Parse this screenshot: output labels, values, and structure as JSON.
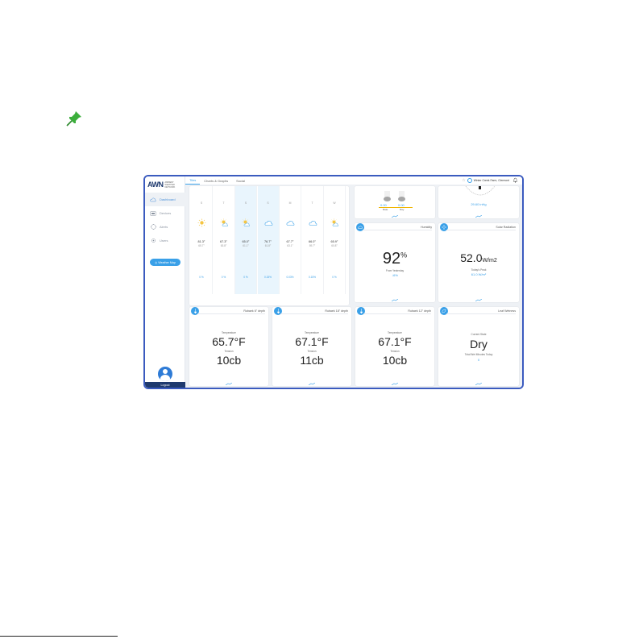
{
  "app": {
    "logo_mark": "AWN",
    "logo_text": "AMBIENT WEATHER NETWORK",
    "station_name": "Winter Creek Farm, Clermont"
  },
  "nav": {
    "items": [
      {
        "label": "Dashboard",
        "active": true,
        "icon": "cloud-icon"
      },
      {
        "label": "Devices",
        "active": false,
        "icon": "device-icon"
      },
      {
        "label": "Alerts",
        "active": false,
        "icon": "alert-icon"
      },
      {
        "label": "Users",
        "active": false,
        "icon": "gear-icon"
      }
    ],
    "weather_map": "Weather Map",
    "logout": "Logout"
  },
  "tabs": [
    {
      "label": "Tiles",
      "active": true
    },
    {
      "label": "Charts & Graphs",
      "active": false
    },
    {
      "label": "Social",
      "active": false
    }
  ],
  "forecast": {
    "days": [
      {
        "day": "S",
        "icon": "sun",
        "hi": "81.3°",
        "lo": "65.7°",
        "rain": "0 %",
        "highlight": false
      },
      {
        "day": "T",
        "icon": "partly-cloudy",
        "hi": "67.3°",
        "lo": "63.8°",
        "rain": "0 %",
        "highlight": false
      },
      {
        "day": "S",
        "icon": "partly-cloudy",
        "hi": "65.0°",
        "lo": "61.1°",
        "rain": "0 %",
        "highlight": true
      },
      {
        "day": "S",
        "icon": "cloud",
        "hi": "76.7°",
        "lo": "61.8°",
        "rain": "0.15%",
        "highlight": true
      },
      {
        "day": "M",
        "icon": "cloud",
        "hi": "67.7°",
        "lo": "63.1°",
        "rain": "0.03%",
        "highlight": false
      },
      {
        "day": "T",
        "icon": "cloud",
        "hi": "66.0°",
        "lo": "59.7°",
        "rain": "0.15%",
        "highlight": false
      },
      {
        "day": "W",
        "icon": "partly-cloudy",
        "hi": "65.9°",
        "lo": "60.8°",
        "rain": "0 %",
        "highlight": false
      }
    ]
  },
  "rain": {
    "rate_value": "0.00",
    "day_value": "0.00",
    "rate_label": "Rate",
    "day_label": "Day"
  },
  "wind_top": {
    "value": "29.60 inHg"
  },
  "humidity": {
    "title": "Humidity",
    "value": "92",
    "unit": "%",
    "sub_label": "From Yesterday",
    "delta": "↓6%"
  },
  "solar": {
    "title": "Solar Radiation",
    "value": "52.0",
    "unit": "W/m2",
    "sub_label": "Today's Peak",
    "peak": "61.0 W/m²"
  },
  "soil": [
    {
      "title": "Rubaek 6\" depth",
      "temp_label": "Temperature",
      "temp": "65.7°F",
      "tension_label": "Tension",
      "tension": "10cb"
    },
    {
      "title": "Rubaek 18\" depth",
      "temp_label": "Temperature",
      "temp": "67.1°F",
      "tension_label": "Tension",
      "tension": "11cb"
    },
    {
      "title": "Rubaek 12\" depth",
      "temp_label": "Temperature",
      "temp": "67.1°F",
      "tension_label": "Tension",
      "tension": "10cb"
    }
  ],
  "leaf": {
    "title": "Leaf Wetness",
    "state_label": "Current State",
    "state": "Dry",
    "minutes_label": "Total Wet Minutes Today",
    "minutes": "0"
  },
  "colors": {
    "accent": "#3aa0e8",
    "frame": "#3b5bbf",
    "navy": "#1f3a6e"
  }
}
